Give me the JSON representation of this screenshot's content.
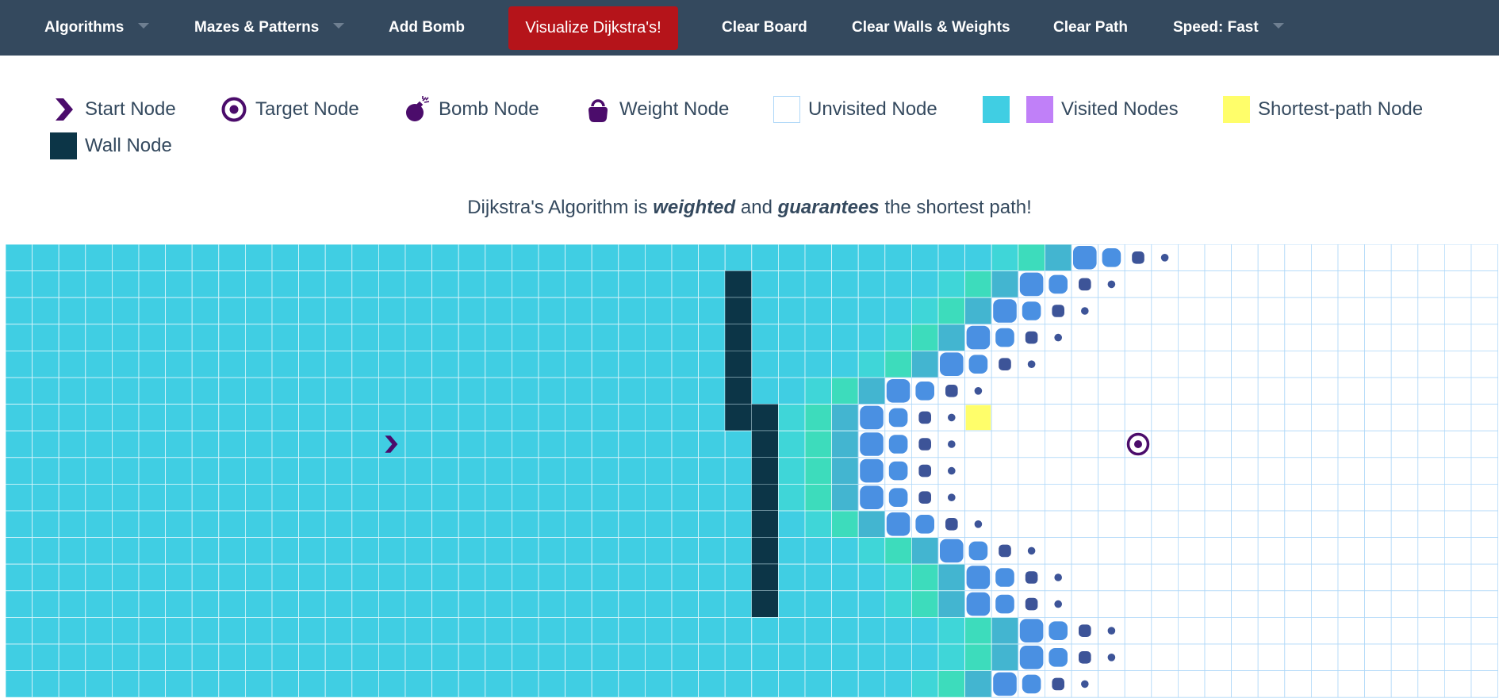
{
  "nav": {
    "algorithms": "Algorithms",
    "mazes": "Mazes & Patterns",
    "add_bomb": "Add Bomb",
    "visualize": "Visualize Dijkstra's!",
    "clear_board": "Clear Board",
    "clear_walls": "Clear Walls & Weights",
    "clear_path": "Clear Path",
    "speed": "Speed: Fast"
  },
  "legend": {
    "start": "Start Node",
    "target": "Target Node",
    "bomb": "Bomb Node",
    "weight": "Weight Node",
    "unvisited": "Unvisited Node",
    "visited": "Visited Nodes",
    "shortest": "Shortest-path Node",
    "wall": "Wall Node"
  },
  "info": {
    "prefix": "Dijkstra's Algorithm is ",
    "weighted": "weighted",
    "middle": " and ",
    "guarantees": "guarantees",
    "suffix": " the shortest path!"
  },
  "colors": {
    "navbar": "#34495e",
    "visualize_button": "#b5141a",
    "visited": "#40cee3",
    "visited_alt": "#c080f8",
    "shortest_path": "#fffe6a",
    "wall": "#0c3547",
    "start_target": "#4b0c6b",
    "frontier_green": "#3ddcbc",
    "frontier_blue": "#4a90e2",
    "frontier_dark": "#3d5498"
  },
  "icons": {
    "start": "chevron-right-icon",
    "target": "target-icon",
    "bomb": "bomb-icon",
    "weight": "weight-icon"
  }
}
